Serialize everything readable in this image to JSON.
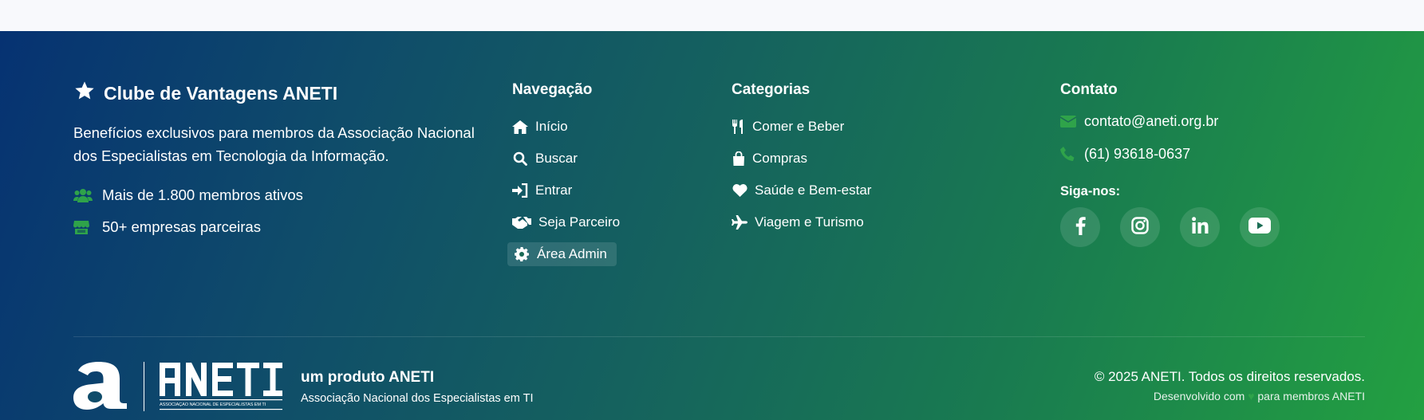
{
  "brand": {
    "title": "Clube de Vantagens ANETI",
    "description": "Benefícios exclusivos para membros da Associação Nacional dos Especialistas em Tecnologia da Informação.",
    "stats": [
      {
        "icon": "users-icon",
        "text": "Mais de 1.800 membros ativos"
      },
      {
        "icon": "store-icon",
        "text": "50+ empresas parceiras"
      }
    ]
  },
  "navigation": {
    "title": "Navegação",
    "items": [
      {
        "icon": "home-icon",
        "label": "Início"
      },
      {
        "icon": "search-icon",
        "label": "Buscar"
      },
      {
        "icon": "sign-in-icon",
        "label": "Entrar"
      },
      {
        "icon": "handshake-icon",
        "label": "Seja Parceiro"
      },
      {
        "icon": "gear-icon",
        "label": "Área Admin"
      }
    ]
  },
  "categories": {
    "title": "Categorias",
    "items": [
      {
        "icon": "utensils-icon",
        "label": "Comer e Beber"
      },
      {
        "icon": "shopping-bag-icon",
        "label": "Compras"
      },
      {
        "icon": "heart-icon",
        "label": "Saúde e Bem-estar"
      },
      {
        "icon": "plane-icon",
        "label": "Viagem e Turismo"
      }
    ]
  },
  "contact": {
    "title": "Contato",
    "email": "contato@aneti.org.br",
    "phone": "(61) 93618-0637",
    "follow_label": "Siga-nos:",
    "socials": [
      "facebook-icon",
      "instagram-icon",
      "linkedin-icon",
      "youtube-icon"
    ]
  },
  "bottom": {
    "logo_wordmark": "ANETI",
    "logo_tagline": "ASSOCIAÇÃO NACIONAL DE ESPECIALISTAS EM TI",
    "product_title": "um produto ANETI",
    "product_subtitle": "Associação Nacional dos Especialistas em TI",
    "copyright": "© 2025 ANETI. Todos os direitos reservados.",
    "dev_prefix": "Desenvolvido com",
    "dev_suffix": "para membros ANETI"
  },
  "colors": {
    "accent_green": "#2fa34a",
    "gradient_start": "#063272",
    "gradient_end": "#23a041"
  }
}
